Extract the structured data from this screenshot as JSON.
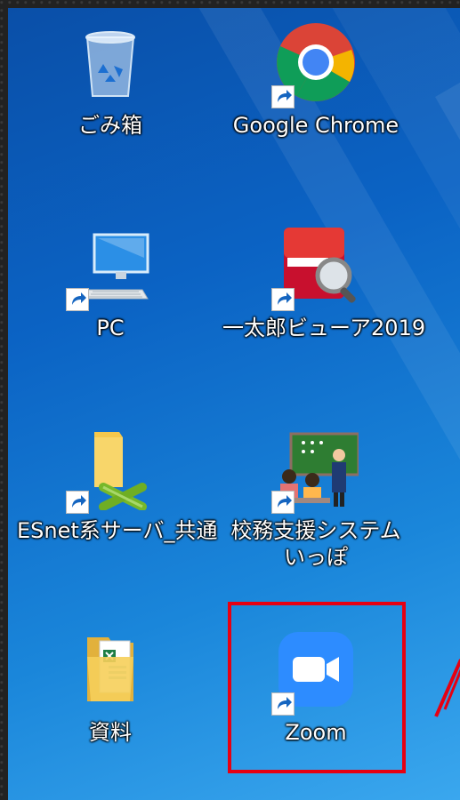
{
  "desktop": {
    "icons": [
      {
        "label": "ごみ箱",
        "icon": "recycle-bin-icon",
        "shortcut": false
      },
      {
        "label": "Google Chrome",
        "icon": "chrome-icon",
        "shortcut": true
      },
      {
        "label": "PC",
        "icon": "computer-icon",
        "shortcut": true
      },
      {
        "label": "一太郎ビューア2019",
        "icon": "ichitaro-viewer-icon",
        "shortcut": true
      },
      {
        "label": "ESnet系サーバ_共通",
        "icon": "network-folder-icon",
        "shortcut": true
      },
      {
        "label": "校務支援システム",
        "label2": "いっぽ",
        "icon": "school-system-icon",
        "shortcut": true
      },
      {
        "label": "資料",
        "icon": "documents-folder-icon",
        "shortcut": false
      },
      {
        "label": "Zoom",
        "icon": "zoom-icon",
        "shortcut": true
      }
    ]
  },
  "highlight": {
    "target": "Zoom",
    "color": "#e60012"
  }
}
